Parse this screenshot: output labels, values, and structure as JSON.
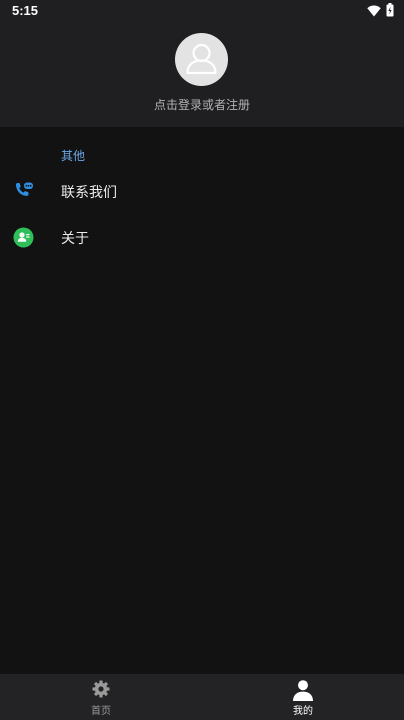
{
  "status_bar": {
    "time": "5:15",
    "wifi_icon": "wifi-icon",
    "battery_icon": "battery-icon"
  },
  "profile": {
    "avatar_icon": "user-avatar-icon",
    "login_prompt": "点击登录或者注册"
  },
  "section": {
    "title": "其他",
    "items": [
      {
        "label": "联系我们",
        "icon": "phone-chat-icon",
        "icon_color": "#2f8fe0"
      },
      {
        "label": "关于",
        "icon": "person-badge-icon",
        "icon_color": "#2fbf5a"
      }
    ]
  },
  "bottom_nav": {
    "tabs": [
      {
        "label": "首页",
        "icon": "gear-icon",
        "active": false
      },
      {
        "label": "我的",
        "icon": "person-icon",
        "active": true
      }
    ]
  },
  "colors": {
    "background": "#121212",
    "header": "#1f1f21",
    "accent": "#6aa6e8",
    "nav_bg": "#232325"
  }
}
